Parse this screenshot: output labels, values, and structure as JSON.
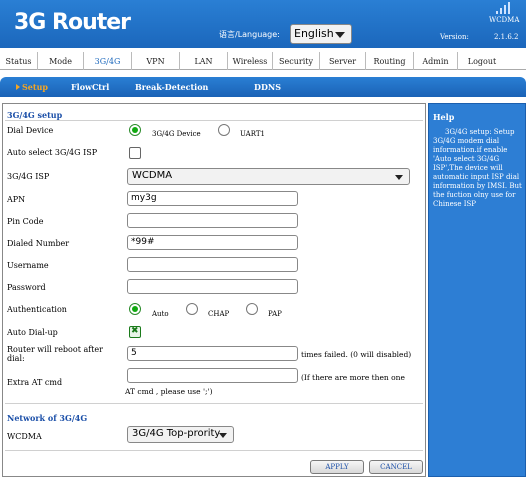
{
  "header": {
    "logo": "3G Router",
    "language_label": "语言/Language:",
    "language_value": "English",
    "network_type": "WCDMA",
    "version_label": "Version:",
    "version_value": "2.1.6.2"
  },
  "topnav": [
    "Status",
    "Mode",
    "3G/4G",
    "VPN",
    "LAN",
    "Wireless",
    "Security",
    "Server",
    "Routing",
    "Admin",
    "Logout"
  ],
  "subnav": [
    "Setup",
    "FlowCtrl",
    "Break-Detection",
    "DDNS"
  ],
  "setup": {
    "title": "3G/4G setup",
    "dial_device_label": "Dial Device",
    "dial_device_opt1": "3G/4G Device",
    "dial_device_opt2": "UART1",
    "auto_isp_label": "Auto select 3G/4G ISP",
    "isp_label": "3G/4G ISP",
    "isp_value": "WCDMA",
    "apn_label": "APN",
    "apn_value": "my3g",
    "pin_label": "Pin Code",
    "pin_value": "",
    "dialed_label": "Dialed Number",
    "dialed_value": "*99#",
    "username_label": "Username",
    "username_value": "",
    "password_label": "Password",
    "password_value": "",
    "auth_label": "Authentication",
    "auth_opt1": "Auto",
    "auth_opt2": "CHAP",
    "auth_opt3": "PAP",
    "autodial_label": "Auto Dial-up",
    "reboot_label_1": "Router will reboot after",
    "reboot_label_2": "dial:",
    "reboot_value": "5",
    "reboot_suffix": "times failed. (0 will disabled)",
    "extra_at_label": "Extra AT cmd",
    "extra_at_value": "",
    "extra_at_hint_1": "(If there are more then one",
    "extra_at_hint_2": "AT cmd , please use ';')"
  },
  "network": {
    "title": "Network of 3G/4G",
    "wcdma_label": "WCDMA",
    "wcdma_value": "3G/4G Top-prority"
  },
  "buttons": {
    "apply": "APPLY",
    "cancel": "CANCEL"
  },
  "help": {
    "title": "Help",
    "body": "3G/4G setup: Setup 3G/4G modem dial information.if enable 'Auto select 3G/4G ISP',The device will automatic input ISP dial information by IMSI. But the fuction olny use for Chinese ISP"
  },
  "colors": {
    "brand_blue": "#2a7fd4",
    "active_orange": "#f5a623",
    "section_blue": "#1b4fa8"
  }
}
